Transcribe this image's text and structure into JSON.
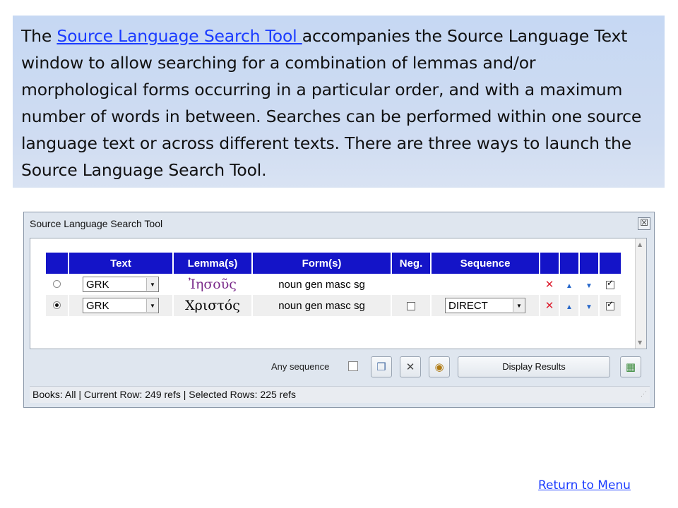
{
  "intro": {
    "pre": "The ",
    "link": "Source Language Search Tool ",
    "post": "accompanies the Source Language Text window to allow searching for a combination of lemmas and/or morphological forms occurring in a particular order, and with a maximum number of words in between. Searches can be performed within one source language text or across different texts. There are three ways to launch the Source Language Search Tool."
  },
  "window": {
    "title": "Source Language Search Tool",
    "close_glyph": "☒"
  },
  "grid": {
    "headers": [
      "",
      "Text",
      "Lemma(s)",
      "Form(s)",
      "Neg.",
      "Sequence",
      "",
      "",
      "",
      ""
    ],
    "rows": [
      {
        "selected": false,
        "text": "GRK",
        "lemma": "Ἰησοῦς",
        "form": "noun gen masc sg",
        "neg_checkbox": false,
        "sequence": "",
        "include": true
      },
      {
        "selected": true,
        "text": "GRK",
        "lemma": "Χριστός",
        "form": "noun gen masc sg",
        "neg_checkbox": true,
        "sequence": "DIRECT",
        "include": true
      }
    ]
  },
  "toolbar": {
    "any_sequence_label": "Any sequence",
    "display_results_label": "Display Results"
  },
  "status": {
    "text": "Books: All | Current Row: 249 refs | Selected Rows: 225 refs"
  },
  "footer": {
    "return_link": "Return to Menu"
  }
}
